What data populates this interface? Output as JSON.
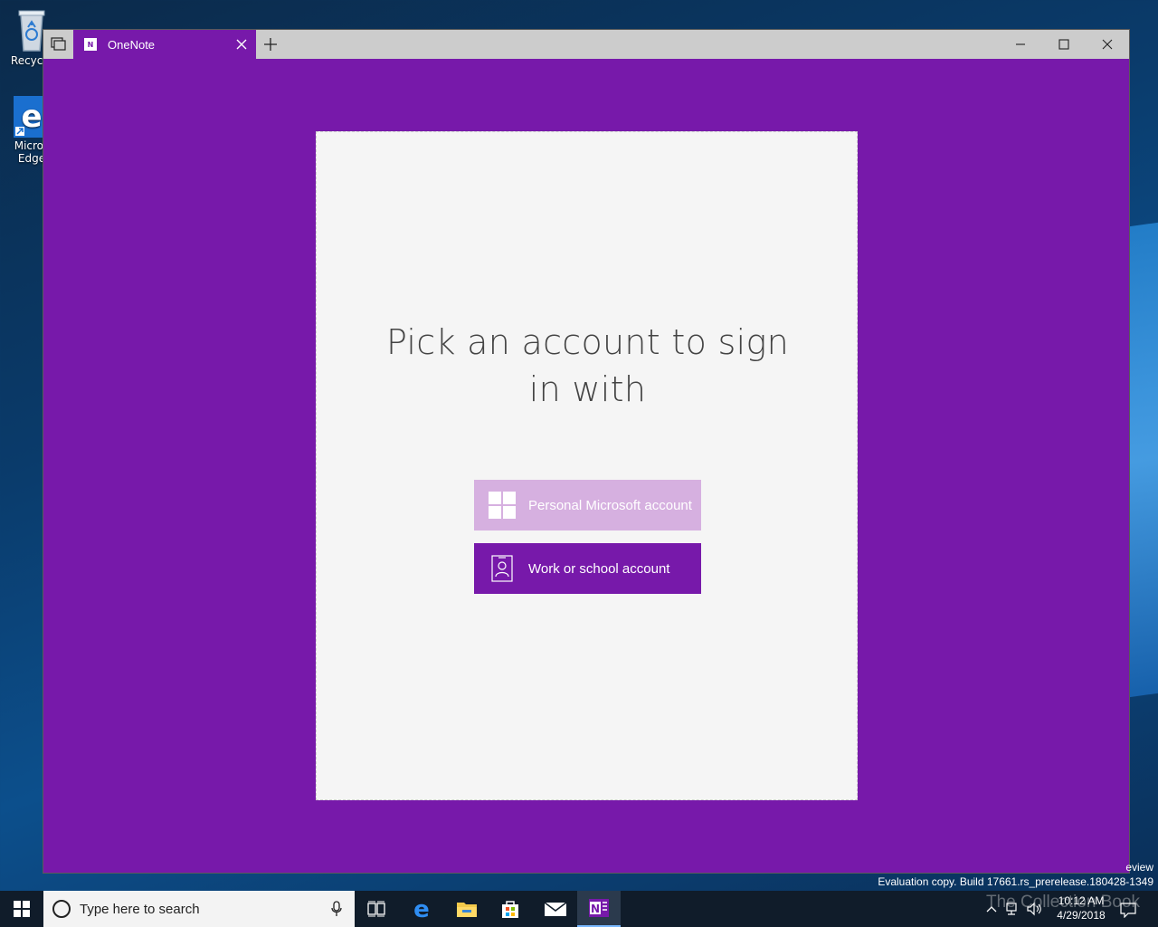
{
  "desktop": {
    "icons": [
      {
        "label": "Recycle",
        "icon": "recycle-bin-icon"
      },
      {
        "label": "Micros Edge",
        "icon": "edge-icon"
      }
    ]
  },
  "window": {
    "tab_title": "OneNote",
    "app_icon_letter": "N",
    "accent_color": "#7719aa"
  },
  "dialog": {
    "title": "Pick an account to sign in with",
    "buttons": [
      {
        "label": "Personal Microsoft account",
        "icon": "windows-logo-icon",
        "color": "#d6b0e0"
      },
      {
        "label": "Work or school account",
        "icon": "badge-person-icon",
        "color": "#7719aa"
      }
    ]
  },
  "system": {
    "eval_line1": "eview",
    "eval_line2": "Evaluation copy. Build 17661.rs_prerelease.180428-1349"
  },
  "taskbar": {
    "search_placeholder": "Type here to search",
    "clock_time": "10:12 AM",
    "clock_date": "4/29/2018",
    "watermark": "The Collection Book"
  }
}
